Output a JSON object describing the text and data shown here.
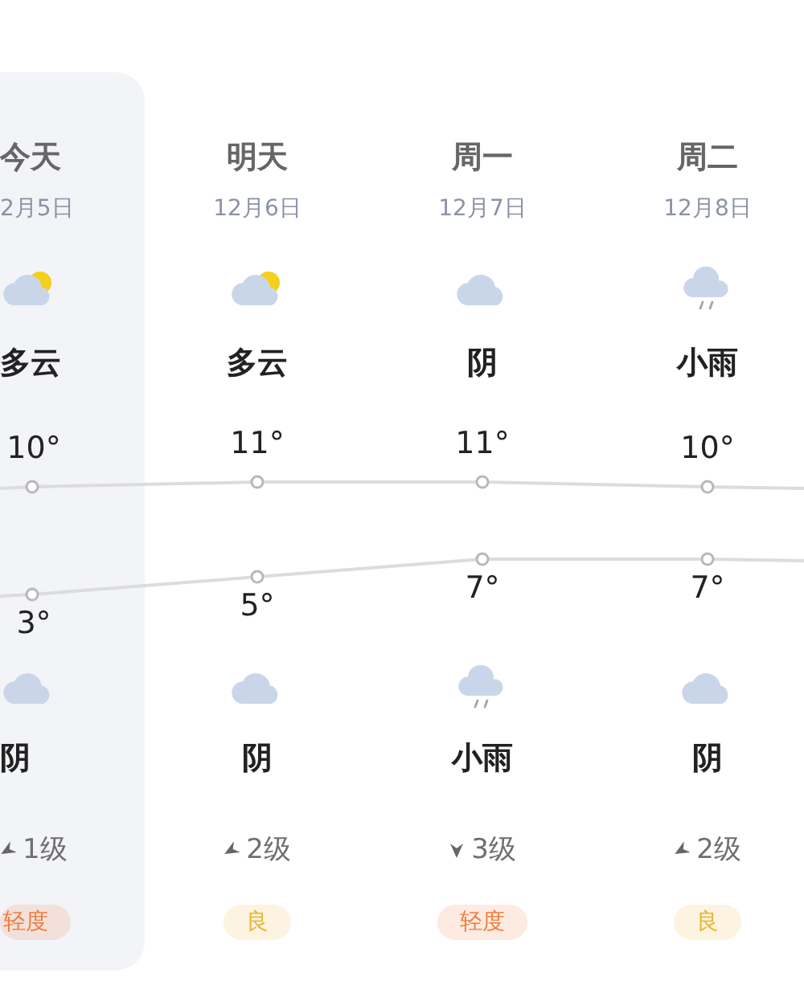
{
  "days": [
    {
      "name": "今天",
      "date": "2月5日",
      "selected": true,
      "day_sky": {
        "kind": "partly_cloudy",
        "label": "多云"
      },
      "high": "10°",
      "low": "3°",
      "night_sky": {
        "kind": "cloudy",
        "label": "阴"
      },
      "wind": {
        "kind": "sw",
        "label": "1级"
      },
      "aqi": {
        "label": "轻度",
        "color": "#f07c3c"
      }
    },
    {
      "name": "明天",
      "date": "12月6日",
      "selected": false,
      "day_sky": {
        "kind": "partly_cloudy",
        "label": "多云"
      },
      "high": "11°",
      "low": "5°",
      "night_sky": {
        "kind": "cloudy",
        "label": "阴"
      },
      "wind": {
        "kind": "sw",
        "label": "2级"
      },
      "aqi": {
        "label": "良",
        "color": "#e9b431"
      }
    },
    {
      "name": "周一",
      "date": "12月7日",
      "selected": false,
      "day_sky": {
        "kind": "cloudy",
        "label": "阴"
      },
      "high": "11°",
      "low": "7°",
      "night_sky": {
        "kind": "light_rain",
        "label": "小雨"
      },
      "wind": {
        "kind": "s",
        "label": "3级"
      },
      "aqi": {
        "label": "轻度",
        "color": "#f07c3c"
      }
    },
    {
      "name": "周二",
      "date": "12月8日",
      "selected": false,
      "day_sky": {
        "kind": "light_rain",
        "label": "小雨"
      },
      "high": "10°",
      "low": "7°",
      "night_sky": {
        "kind": "cloudy",
        "label": "阴"
      },
      "wind": {
        "kind": "sw",
        "label": "2级"
      },
      "aqi": {
        "label": "良",
        "color": "#e9b431"
      }
    }
  ]
}
